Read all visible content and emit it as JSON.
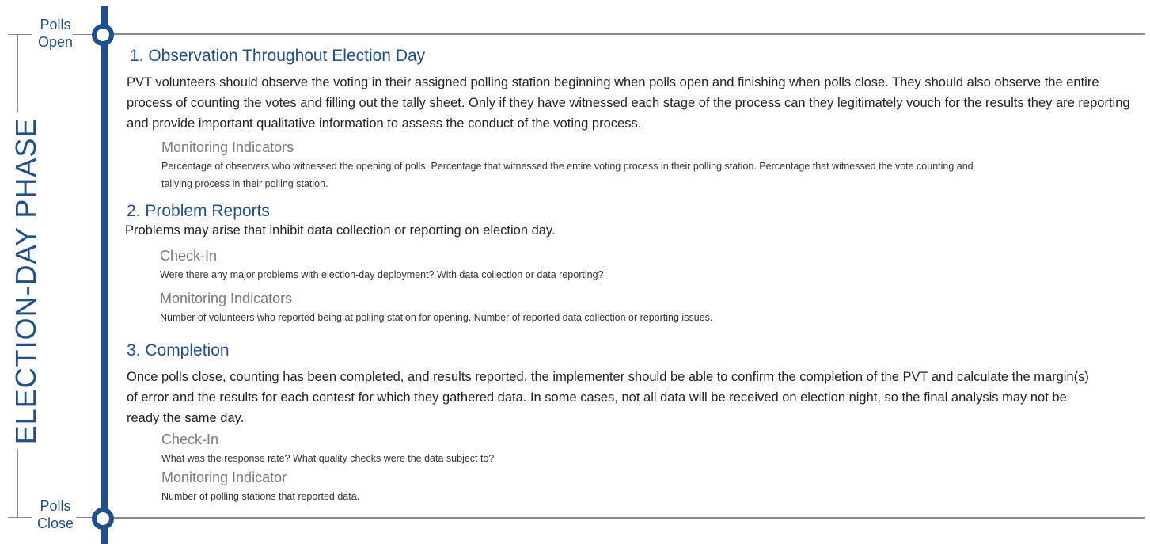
{
  "timeline": {
    "phase_title": "ELECTION-DAY PHASE",
    "start_label_1": "Polls",
    "start_label_2": "Open",
    "end_label_1": "Polls",
    "end_label_2": "Close"
  },
  "sections": [
    {
      "heading": "1. Observation Throughout Election Day",
      "body": "PVT volunteers should observe the voting in their assigned polling station beginning when polls open and finishing when polls close. They should also observe the entire process of counting the votes and filling out the tally sheet. Only if they have witnessed each stage of the process can they legitimately vouch for the results they are reporting and provide important qualitative information to assess the conduct of the voting process.",
      "subsections": [
        {
          "title": "Monitoring Indicators",
          "text": "Percentage of observers who witnessed the opening of polls. Percentage that witnessed the entire voting process in their polling station. Percentage that witnessed the vote counting and tallying process in their polling station."
        }
      ]
    },
    {
      "heading": "2. Problem Reports",
      "body": "Problems may arise that inhibit data collection or reporting on election day.",
      "subsections": [
        {
          "title": "Check-In",
          "text": "Were there any major problems with election-day deployment? With data collection or data reporting?"
        },
        {
          "title": "Monitoring Indicators",
          "text": "Number of volunteers who reported being at polling station for opening. Number of reported data collection or reporting issues."
        }
      ]
    },
    {
      "heading": "3. Completion",
      "body": "Once polls close, counting has been completed, and results reported, the implementer should be able to confirm the completion of the PVT and calculate the margin(s) of error and the results for each contest for which they gathered data. In some cases, not all data will be received on election night, so the final analysis may not be ready the same day.",
      "subsections": [
        {
          "title": "Check-In",
          "text": "What was the response rate? What quality checks were the data subject to?"
        },
        {
          "title": "Monitoring Indicator",
          "text": "Number of polling stations that reported data."
        }
      ]
    }
  ],
  "colors": {
    "accent": "#1f4f8c",
    "rule": "#8a8a8a",
    "subheading": "#7a7a7a"
  }
}
